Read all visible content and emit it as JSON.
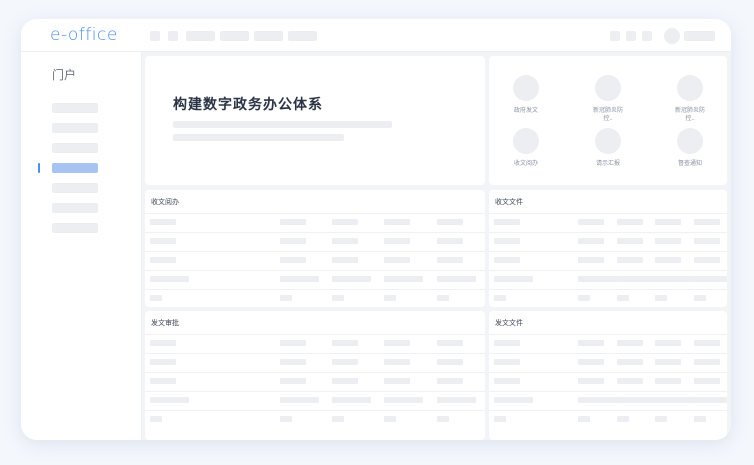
{
  "header": {
    "logo_text": "e-office"
  },
  "sidebar": {
    "title": "门户",
    "item_count": 7,
    "active_index": 3
  },
  "hero": {
    "title": "构建数字政务办公体系"
  },
  "quick_links": [
    {
      "label": "政府发文",
      "icon": "document-icon"
    },
    {
      "label": "新冠肺炎防控..",
      "icon": "health-icon"
    },
    {
      "label": "新冠肺炎防控..",
      "icon": "health-icon"
    },
    {
      "label": "收文阅办",
      "icon": "inbox-icon"
    },
    {
      "label": "请示汇报",
      "icon": "report-icon"
    },
    {
      "label": "督查通知",
      "icon": "notice-icon"
    }
  ],
  "panels": [
    {
      "title": "收文阅办"
    },
    {
      "title": "收文文件"
    },
    {
      "title": "发文审批"
    },
    {
      "title": "发文文件"
    }
  ],
  "colors": {
    "accent": "#4a8ef0",
    "active_item": "#a8c4f5",
    "placeholder": "#eceef2"
  }
}
